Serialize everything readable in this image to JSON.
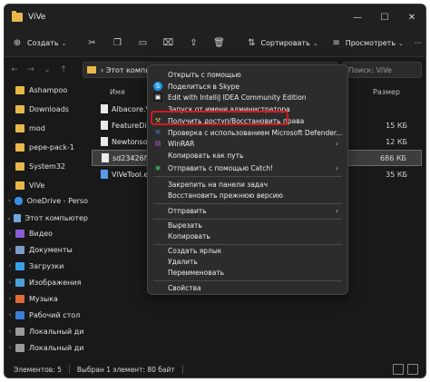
{
  "window": {
    "title": "ViVe",
    "minimize": "—",
    "maximize": "☐",
    "close": "✕"
  },
  "toolbar": {
    "create_label": "Создать",
    "sort_label": "Сортировать",
    "view_label": "Просмотреть",
    "more": "···"
  },
  "nav": {
    "back": "←",
    "forward": "→",
    "dropdown": "⌄",
    "up": "↑",
    "address": "›  Этот компьютер  ›  Локальный диск (D:)  ›  ...  ›  ViVe",
    "search_placeholder": "Поиск: ViVe"
  },
  "sidebar": {
    "items": [
      {
        "label": "Ashampoo",
        "color": "#e8b84a"
      },
      {
        "label": "Downloads",
        "color": "#e8b84a"
      },
      {
        "label": "mod",
        "color": "#e8b84a"
      },
      {
        "label": "pepe-pack-1",
        "color": "#e8b84a"
      },
      {
        "label": "System32",
        "color": "#e8b84a"
      },
      {
        "label": "ViVe",
        "color": "#e8b84a"
      },
      {
        "label": "OneDrive - Perso",
        "color": "#3a8ee6"
      },
      {
        "label": "Этот компьютер",
        "color": "#6fa8dc"
      },
      {
        "label": "Видео",
        "color": "#8a5cd6"
      },
      {
        "label": "Документы",
        "color": "#7a9cc6"
      },
      {
        "label": "Загрузки",
        "color": "#3aa0e6"
      },
      {
        "label": "Изображения",
        "color": "#4aa0d6"
      },
      {
        "label": "Музыка",
        "color": "#e06a3a"
      },
      {
        "label": "Рабочий стол",
        "color": "#3a7ed6"
      },
      {
        "label": "Локальный ди",
        "color": "#9a9a9a"
      },
      {
        "label": "Локальный ди",
        "color": "#9a9a9a"
      }
    ]
  },
  "files": {
    "col_name": "Имя",
    "col_size": "Размер",
    "rows": [
      {
        "name": "Albacore.ViVe",
        "size": ""
      },
      {
        "name": "FeatureDictio",
        "size": "15 КБ"
      },
      {
        "name": "Newtonsoft.Js",
        "size": "12 КБ"
      },
      {
        "name": "sd23426ffdw",
        "size": "686 КБ"
      },
      {
        "name": "ViVeTool.exe",
        "size": "35 КБ"
      }
    ]
  },
  "status": {
    "count": "Элементов: 5",
    "selected": "Выбран 1 элемент: 80 байт"
  },
  "menu": {
    "items": [
      {
        "label": "Открыть с помощью",
        "icon": ""
      },
      {
        "label": "Поделиться в Skype",
        "icon": "S"
      },
      {
        "label": "Edit with IntelliJ IDEA Community Edition",
        "icon": "▣"
      },
      {
        "label": "Запуск от имени администратора",
        "icon": ""
      },
      {
        "label": "Получить доступ/Восстановить права",
        "icon": "⚒"
      },
      {
        "label": "Проверка с использованием Microsoft Defender...",
        "icon": "⛨"
      },
      {
        "label": "WinRAR",
        "icon": "▤",
        "sub": "›"
      },
      {
        "label": "Копировать как путь",
        "icon": ""
      },
      {
        "label": "Отправить с помощью Catch!",
        "icon": "◉",
        "sub": "›"
      },
      {
        "label": "Закрепить на панели задач",
        "icon": ""
      },
      {
        "label": "Восстановить прежнюю версию",
        "icon": ""
      },
      {
        "label": "Отправить",
        "icon": "",
        "sub": "›"
      },
      {
        "label": "Вырезать",
        "icon": ""
      },
      {
        "label": "Копировать",
        "icon": ""
      },
      {
        "label": "Создать ярлык",
        "icon": ""
      },
      {
        "label": "Удалить",
        "icon": ""
      },
      {
        "label": "Переименовать",
        "icon": ""
      },
      {
        "label": "Свойства",
        "icon": ""
      }
    ]
  },
  "colors": {
    "accent": "#d61a1a",
    "folder": "#e8b84a"
  }
}
